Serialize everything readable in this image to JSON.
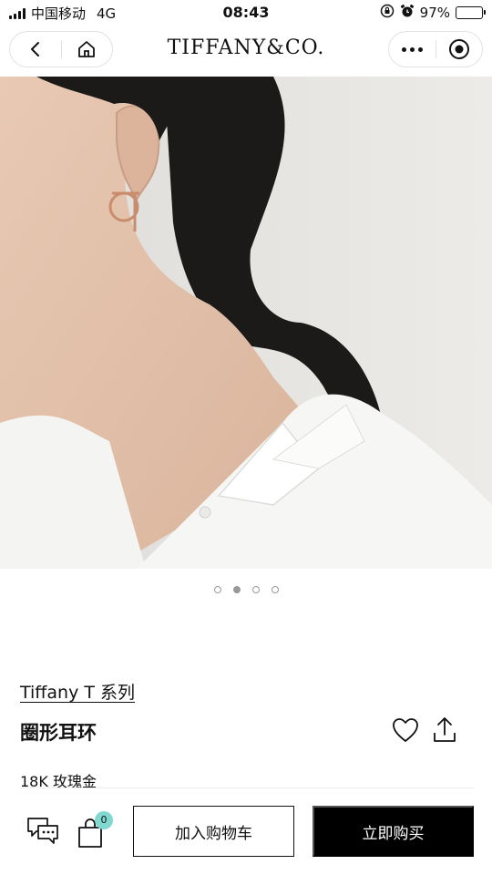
{
  "status_bar": {
    "carrier": "中国移动",
    "network": "4G",
    "time": "08:43",
    "battery_percent_text": "97%",
    "battery_level": 0.97
  },
  "nav": {
    "brand": "TIFFANY&CO.",
    "back_icon": "chevron-left-icon",
    "home_icon": "home-icon",
    "more_icon": "more-dots-icon",
    "close_icon": "target-circle-icon"
  },
  "gallery": {
    "image_count": 4,
    "active_index": 1
  },
  "product": {
    "collection": "Tiffany T 系列",
    "name": "圈形耳环",
    "material": "18K 玫瑰金"
  },
  "actions": {
    "cart_count": "0",
    "add_to_cart": "加入购物车",
    "buy_now": "立即购买",
    "chat_icon": "chat-bubbles-icon",
    "cart_icon": "shopping-bag-icon",
    "wishlist_icon": "heart-icon",
    "share_icon": "share-icon"
  },
  "colors": {
    "accent_badge": "#81d8d0",
    "primary_button": "#000000"
  }
}
